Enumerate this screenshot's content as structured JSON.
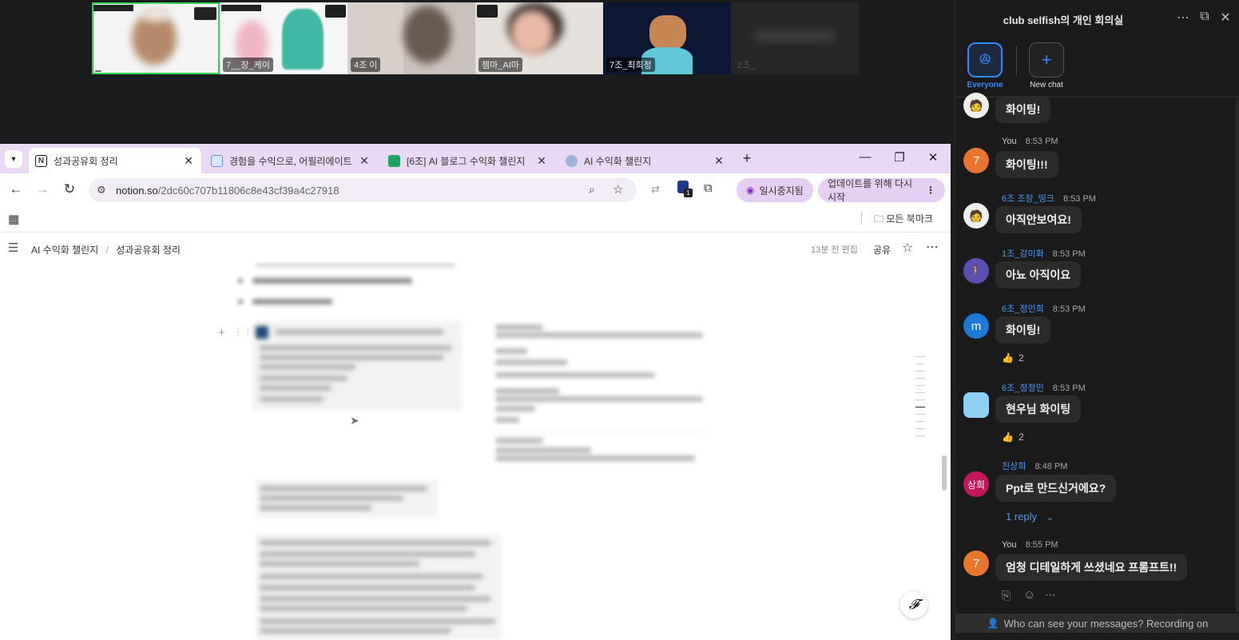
{
  "video_strip": {
    "tiles": [
      {
        "name": "",
        "active": true
      },
      {
        "name": "7__장_케이"
      },
      {
        "name": "4조 이"
      },
      {
        "name": "젬마_AI마"
      },
      {
        "name": "7조_최희정"
      },
      {
        "name": "2조_"
      }
    ]
  },
  "browser": {
    "tabs": [
      {
        "title": "성과공유회 정리",
        "active": true
      },
      {
        "title": "경험을 수익으로, 어필리에이트"
      },
      {
        "title": "[6조] AI 블로그 수익화 챌린지"
      },
      {
        "title": "AI 수익화 챌린지"
      }
    ],
    "url_domain": "notion.so",
    "url_path": "/2dc60c707b11806c8e43cf39a4c27918",
    "extension_badge": "1",
    "paused_label": "일시중지됨",
    "update_label": "업데이트를 위해 다시 시작",
    "bookmarks_all": "모든 북마크"
  },
  "notion": {
    "breadcrumb": [
      "AI 수익화 챌린지",
      "성과공유회 정리"
    ],
    "edited": "13분 전 편집",
    "share": "공유"
  },
  "chat": {
    "title": "club selfish의 개인 회의실",
    "everyone_label": "Everyone",
    "new_chat_label": "New chat",
    "messages": [
      {
        "text": "화이팅!",
        "avatar": "anime"
      },
      {
        "sender": "You",
        "time": "8:53 PM",
        "text": "화이팅!!!",
        "avatar_text": "7",
        "avatar_color": "#e8762c"
      },
      {
        "sender": "6조 조장_띵크",
        "time": "8:53 PM",
        "text": "아직안보여요!",
        "avatar": "anime"
      },
      {
        "sender": "1조_강미화",
        "time": "8:53 PM",
        "text": "아뇨 아직이요",
        "avatar": "photo"
      },
      {
        "sender": "6조_정민희",
        "time": "8:53 PM",
        "text": "화이팅!",
        "avatar_text": "m",
        "avatar_color": "#1a7ad6",
        "reaction": "2"
      },
      {
        "sender": "6조_정정민",
        "time": "8:53 PM",
        "text": "현우님 화이팅",
        "avatar_color": "#8ed1f5",
        "reaction": "2"
      },
      {
        "sender": "진상희",
        "time": "8:48 PM",
        "text": "Ppt로 만드신거에요?",
        "avatar_text": "상희",
        "avatar_color": "#c2185b",
        "replies": "1 reply"
      },
      {
        "sender": "You",
        "time": "8:55 PM",
        "text": "엄청 디테일하게 쓰셨네요 프롬프트!!",
        "avatar_text": "7",
        "avatar_color": "#e8762c"
      }
    ],
    "footer": "Who can see your messages? Recording on"
  }
}
